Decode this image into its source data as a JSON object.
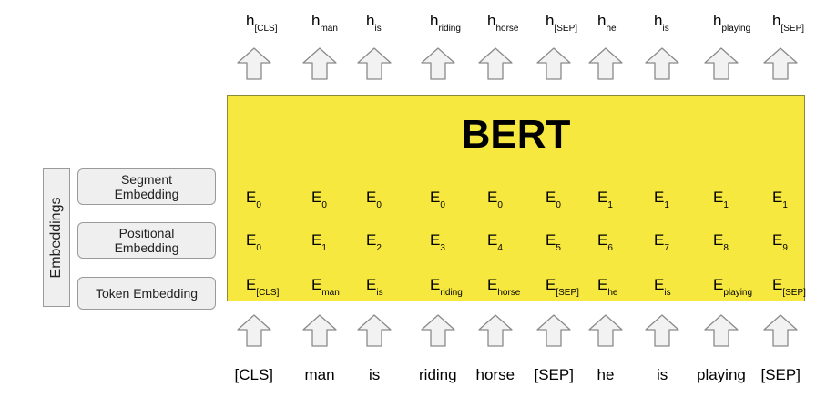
{
  "title": "BERT",
  "side_label": "Embeddings",
  "embedding_types": [
    {
      "line1": "Segment",
      "line2": "Embedding"
    },
    {
      "line1": "Positional",
      "line2": "Embedding"
    },
    {
      "line1": "Token Embedding",
      "line2": ""
    }
  ],
  "columns": [
    {
      "token": "[CLS]",
      "h": {
        "base": "h",
        "sub": "[CLS]"
      },
      "segment": {
        "base": "E",
        "sub": "0"
      },
      "position": {
        "base": "E",
        "sub": "0"
      },
      "token_emb": {
        "base": "E",
        "sub": "[CLS]"
      }
    },
    {
      "token": "man",
      "h": {
        "base": "h",
        "sub": "man"
      },
      "segment": {
        "base": "E",
        "sub": "0"
      },
      "position": {
        "base": "E",
        "sub": "1"
      },
      "token_emb": {
        "base": "E",
        "sub": "man"
      }
    },
    {
      "token": "is",
      "h": {
        "base": "h",
        "sub": "is"
      },
      "segment": {
        "base": "E",
        "sub": "0"
      },
      "position": {
        "base": "E",
        "sub": "2"
      },
      "token_emb": {
        "base": "E",
        "sub": "is"
      }
    },
    {
      "token": "riding",
      "h": {
        "base": "h",
        "sub": "riding"
      },
      "segment": {
        "base": "E",
        "sub": "0"
      },
      "position": {
        "base": "E",
        "sub": "3"
      },
      "token_emb": {
        "base": "E",
        "sub": "riding"
      }
    },
    {
      "token": "horse",
      "h": {
        "base": "h",
        "sub": "horse"
      },
      "segment": {
        "base": "E",
        "sub": "0"
      },
      "position": {
        "base": "E",
        "sub": "4"
      },
      "token_emb": {
        "base": "E",
        "sub": "horse"
      }
    },
    {
      "token": "[SEP]",
      "h": {
        "base": "h",
        "sub": "[SEP]"
      },
      "segment": {
        "base": "E",
        "sub": "0"
      },
      "position": {
        "base": "E",
        "sub": "5"
      },
      "token_emb": {
        "base": "E",
        "sub": "[SEP]"
      }
    },
    {
      "token": "he",
      "h": {
        "base": "h",
        "sub": "he"
      },
      "segment": {
        "base": "E",
        "sub": "1"
      },
      "position": {
        "base": "E",
        "sub": "6"
      },
      "token_emb": {
        "base": "E",
        "sub": "he"
      }
    },
    {
      "token": "is",
      "h": {
        "base": "h",
        "sub": "is"
      },
      "segment": {
        "base": "E",
        "sub": "1"
      },
      "position": {
        "base": "E",
        "sub": "7"
      },
      "token_emb": {
        "base": "E",
        "sub": "is"
      }
    },
    {
      "token": "playing",
      "h": {
        "base": "h",
        "sub": "playing"
      },
      "segment": {
        "base": "E",
        "sub": "1"
      },
      "position": {
        "base": "E",
        "sub": "8"
      },
      "token_emb": {
        "base": "E",
        "sub": "playing"
      }
    },
    {
      "token": "[SEP]",
      "h": {
        "base": "h",
        "sub": "[SEP]"
      },
      "segment": {
        "base": "E",
        "sub": "1"
      },
      "position": {
        "base": "E",
        "sub": "9"
      },
      "token_emb": {
        "base": "E",
        "sub": "[SEP]"
      }
    }
  ],
  "colors": {
    "bert_fill": "#f6e83f",
    "panel_fill": "#efefef",
    "arrow_fill": "#f2f2f2",
    "arrow_stroke": "#8a8a8a"
  }
}
